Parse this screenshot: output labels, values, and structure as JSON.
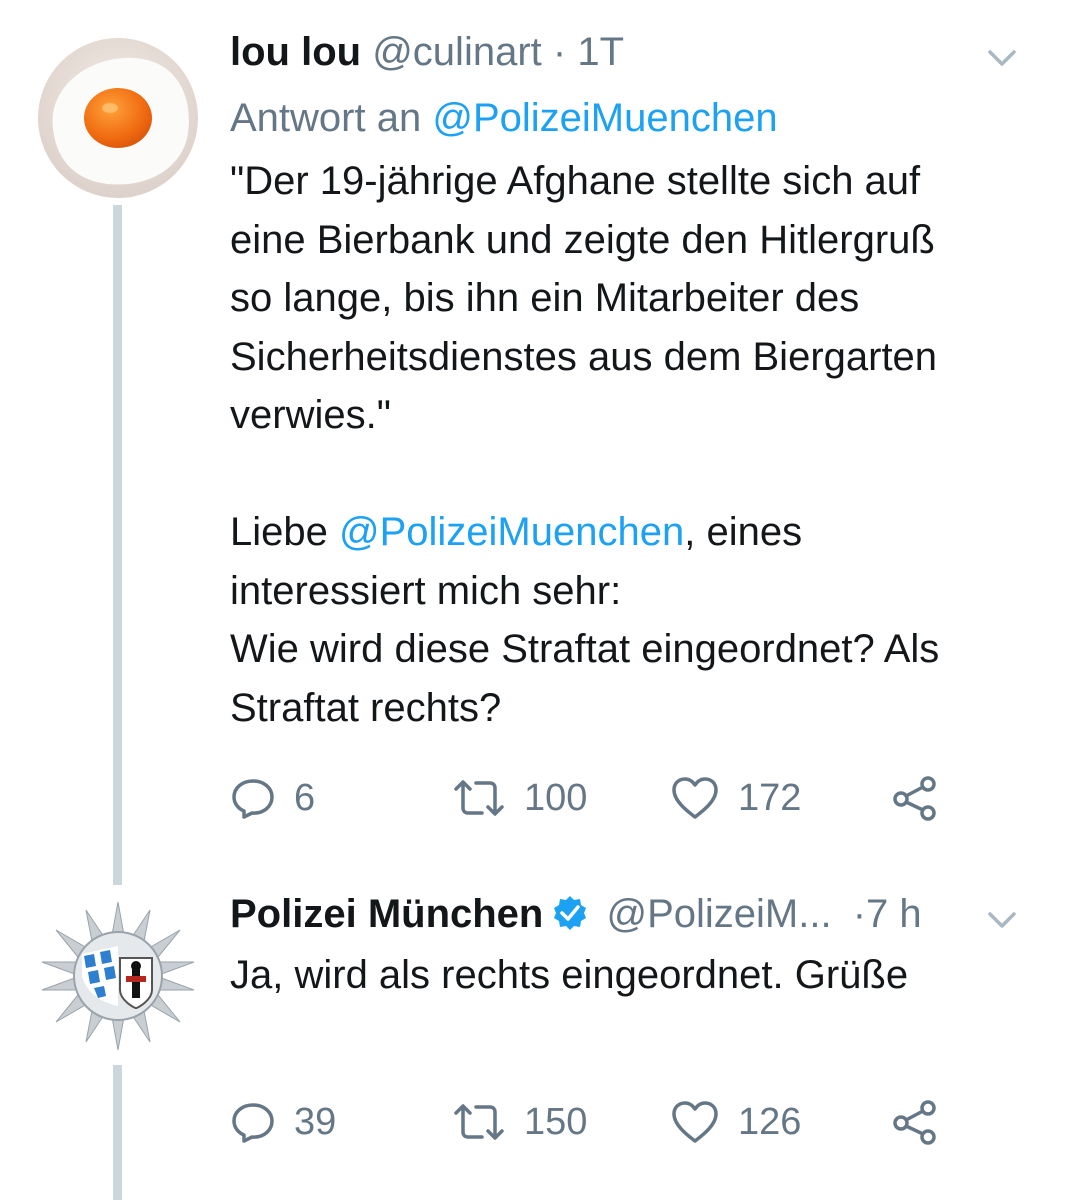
{
  "tweets": [
    {
      "display_name": "lou lou",
      "handle": "@culinart",
      "separator": "·",
      "time": "1T",
      "reply_prefix": "Antwort an",
      "reply_mention": "@PolizeiMuenchen",
      "text_lines": [
        "\"Der 19-jährige Afghane stellte sich auf",
        "eine Bierbank und zeigte den Hitlergruß",
        "so lange, bis ihn ein Mitarbeiter des",
        "Sicherheitsdienstes aus dem Biergarten",
        "verwies.\""
      ],
      "text2_prefix": "Liebe ",
      "text2_mention": "@PolizeiMuenchen",
      "text2_suffix": ", eines",
      "text2_lines": [
        "interessiert mich sehr:",
        "Wie wird diese Straftat eingeordnet? Als",
        "Straftat rechts?"
      ],
      "replies": "6",
      "retweets": "100",
      "likes": "172"
    },
    {
      "display_name": "Polizei München",
      "handle": "@PolizeiM...",
      "separator": "·",
      "time": "7 h",
      "text": "Ja, wird als rechts eingeordnet. Grüße",
      "replies": "39",
      "retweets": "150",
      "likes": "126"
    }
  ],
  "colors": {
    "text": "#14171a",
    "secondary": "#657786",
    "link": "#1da1f2",
    "thread_line": "#ccd6dd"
  },
  "icons": [
    "reply-icon",
    "retweet-icon",
    "like-icon",
    "share-icon",
    "chevron-down-icon",
    "verified-badge-icon"
  ]
}
